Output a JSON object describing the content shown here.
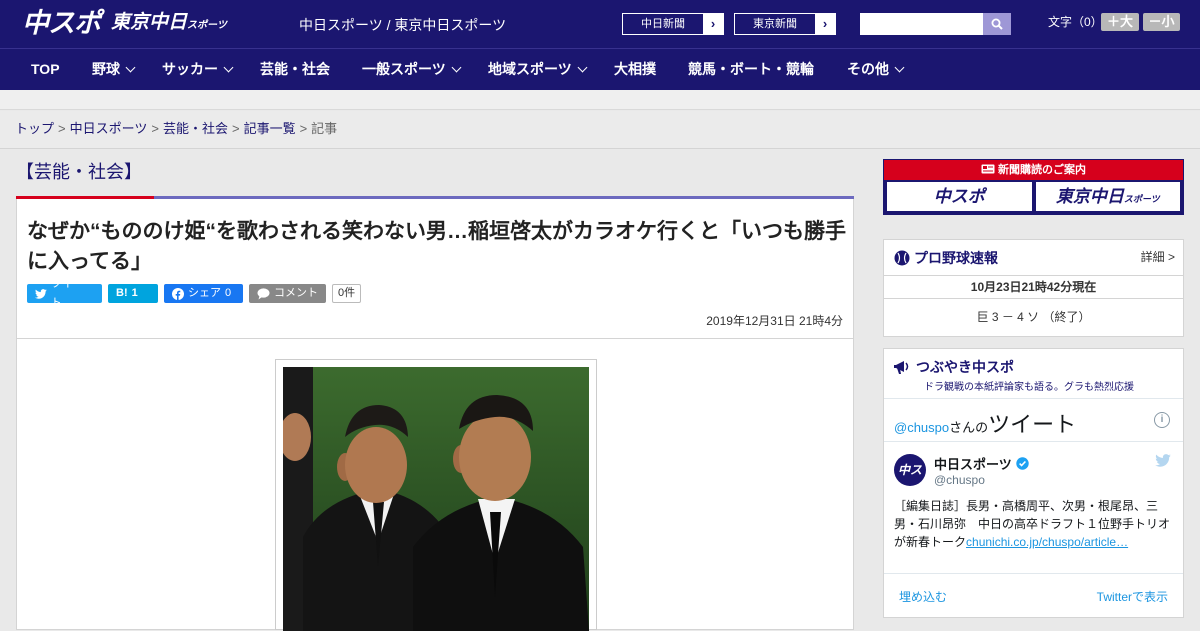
{
  "header": {
    "logo_main": "中スポ",
    "logo_tokyo": "東京中日",
    "logo_tokyo_sub": "スポーツ",
    "site_name": "中日スポーツ / 東京中日スポーツ",
    "ext_links": [
      "中日新聞",
      "東京新聞"
    ],
    "search_placeholder": "",
    "font_label": "文字（0）",
    "font_plus": "＋大",
    "font_minus": "－小"
  },
  "nav": {
    "items": [
      {
        "label": "TOP",
        "dropdown": false
      },
      {
        "label": "野球",
        "dropdown": true
      },
      {
        "label": "サッカー",
        "dropdown": true
      },
      {
        "label": "芸能・社会",
        "dropdown": false
      },
      {
        "label": "一般スポーツ",
        "dropdown": true
      },
      {
        "label": "地域スポーツ",
        "dropdown": true
      },
      {
        "label": "大相撲",
        "dropdown": false
      },
      {
        "label": "競馬・ボート・競輪",
        "dropdown": false
      },
      {
        "label": "その他",
        "dropdown": true
      }
    ]
  },
  "breadcrumb": {
    "items": [
      "トップ",
      "中日スポーツ",
      "芸能・社会",
      "記事一覧"
    ],
    "current": "記事",
    "separator": ">"
  },
  "article": {
    "category": "【芸能・社会】",
    "headline": "なぜか“もののけ姫“を歌わされる笑わない男…稲垣啓太がカラオケ行くと「いつも勝手に入ってる」",
    "share": {
      "tweet": "ツイート",
      "hatena_label": "B!",
      "hatena_count": "1",
      "facebook": "シェア",
      "facebook_count": "0",
      "comment": "コメント",
      "comment_count": "0件"
    },
    "date": "2019年12月31日 21時4分"
  },
  "sidebar": {
    "subscribe": {
      "title": "新聞購読のご案内",
      "btn1": "中スポ",
      "btn2": "東京中日",
      "btn2_sub": "スポーツ"
    },
    "baseball": {
      "title": "プロ野球速報",
      "more": "詳細 >",
      "timestamp": "10月23日21時42分現在",
      "score": "巨 3 － 4 ソ （終了）"
    },
    "tweets": {
      "title": "つぶやき中スポ",
      "subtitle": "ドラ観戦の本紙評論家も語る。グラも熱烈応援",
      "timeline_handle": "@chuspo",
      "timeline_suffix": "さんの",
      "timeline_word": "ツイート",
      "info": "i",
      "account_name": "中日スポーツ",
      "account_handle": "@chuspo",
      "avatar_text": "中スポ",
      "text": "［編集日誌］長男・高橋周平、次男・根尾昂、三男・石川昂弥　中日の高卒ドラフト１位野手トリオが新春トーク",
      "link": "chunichi.co.jp/chuspo/article…",
      "embed": "埋め込む",
      "view_on": "Twitterで表示"
    }
  },
  "colors": {
    "brand_navy": "#1b1670",
    "accent_red": "#d6001c",
    "twitter_blue": "#1da1f2",
    "facebook_blue": "#1877f2"
  }
}
